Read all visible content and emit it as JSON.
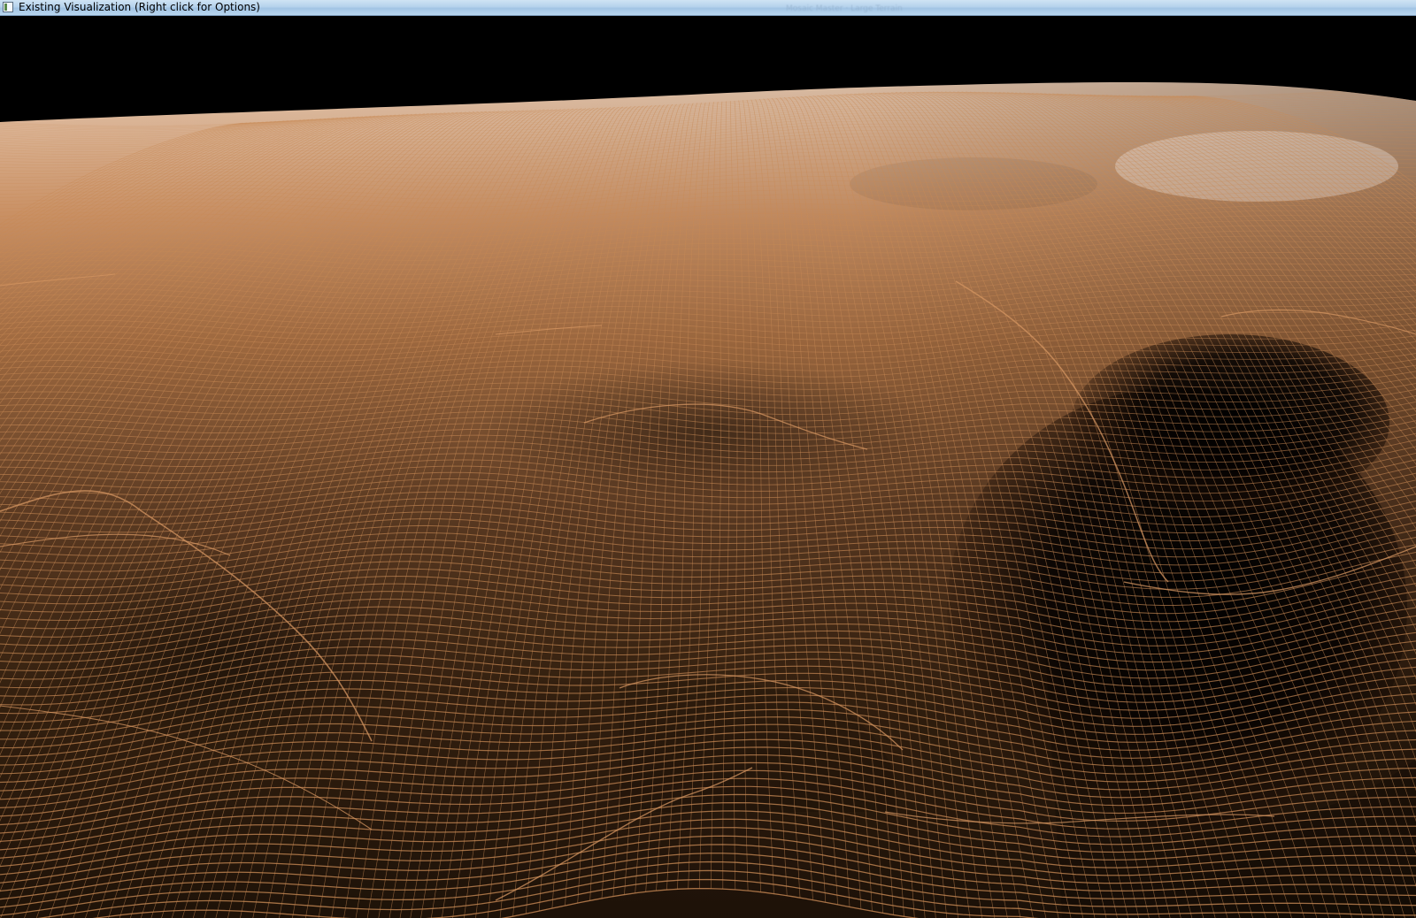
{
  "window": {
    "title": "Existing Visualization (Right click for Options)",
    "faint_title": "Mosaic Master · Large Terrain",
    "titlebar_color": "#b5d2ec"
  },
  "icons": {
    "app": "app-window-icon"
  },
  "viewport": {
    "background": "#000000",
    "mesh_color": "#c98a55",
    "highlight_color": "#f1e4da",
    "shadow_color": "#1a0f08"
  }
}
